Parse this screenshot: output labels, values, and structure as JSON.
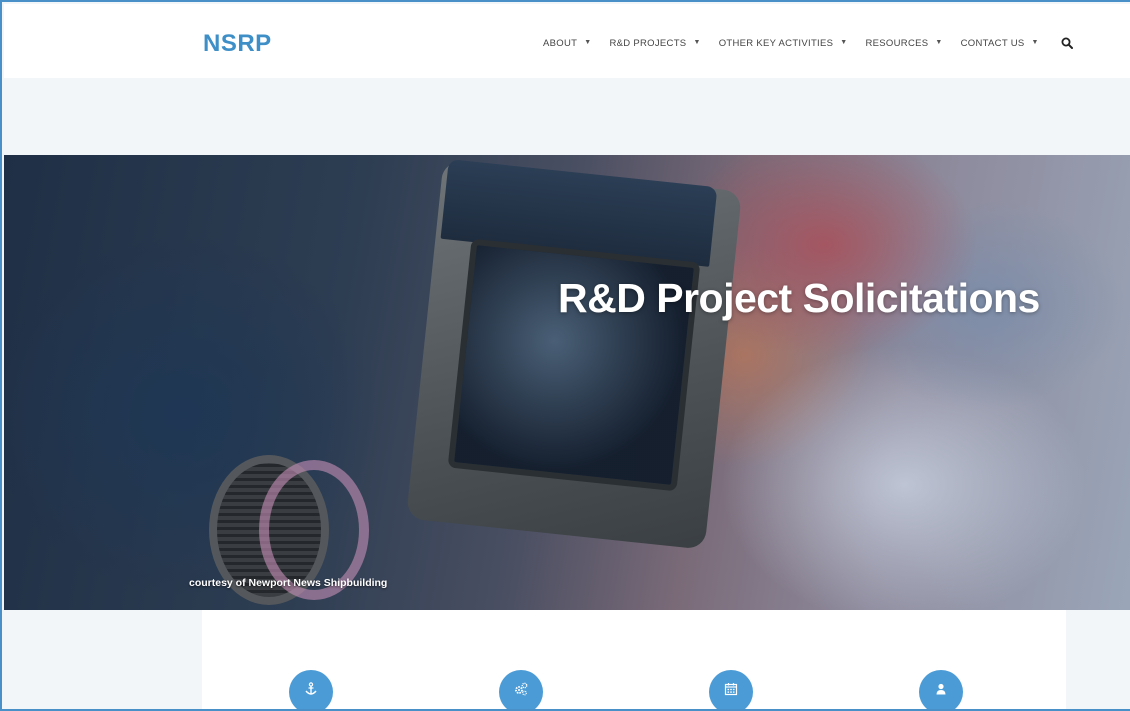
{
  "header": {
    "logo": "NSRP",
    "nav": [
      {
        "label": "ABOUT"
      },
      {
        "label": "R&D PROJECTS"
      },
      {
        "label": "OTHER KEY ACTIVITIES"
      },
      {
        "label": "RESOURCES"
      },
      {
        "label": "CONTACT US"
      }
    ],
    "search_icon": "search-icon"
  },
  "hero": {
    "title": "R&D Project Solicitations",
    "credit": "courtesy of Newport News Shipbuilding"
  },
  "features": [
    {
      "icon": "anchor-icon"
    },
    {
      "icon": "gears-icon"
    },
    {
      "icon": "calendar-icon"
    },
    {
      "icon": "user-icon"
    }
  ],
  "colors": {
    "accent": "#3e8fc7",
    "icon_circle": "#4a9bd6",
    "page_bg": "#f3f6f8"
  }
}
